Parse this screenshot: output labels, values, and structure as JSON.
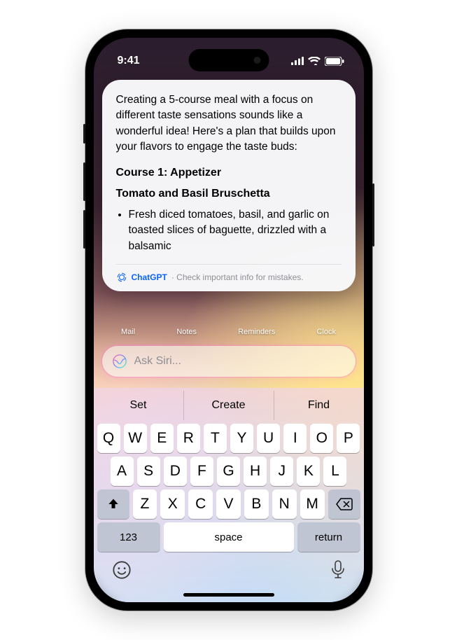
{
  "status": {
    "time": "9:41"
  },
  "response": {
    "intro": "Creating a 5-course meal with a focus on different taste sensations sounds like a wonderful idea! Here's a plan that builds upon your flavors to engage the taste buds:",
    "course_heading": "Course 1: Appetizer",
    "dish_name": "Tomato and Basil Bruschetta",
    "bullet": "Fresh diced tomatoes, basil, and garlic on toasted slices of baguette, drizzled with a balsamic",
    "provider": "ChatGPT",
    "disclaimer": "· Check important info for mistakes."
  },
  "dock": {
    "a": "Mail",
    "b": "Notes",
    "c": "Reminders",
    "d": "Clock"
  },
  "input": {
    "placeholder": "Ask Siri..."
  },
  "suggestions": {
    "a": "Set",
    "b": "Create",
    "c": "Find"
  },
  "keys": {
    "r1": [
      "Q",
      "W",
      "E",
      "R",
      "T",
      "Y",
      "U",
      "I",
      "O",
      "P"
    ],
    "r2": [
      "A",
      "S",
      "D",
      "F",
      "G",
      "H",
      "J",
      "K",
      "L"
    ],
    "r3": [
      "Z",
      "X",
      "C",
      "V",
      "B",
      "N",
      "M"
    ],
    "num": "123",
    "space": "space",
    "ret": "return"
  }
}
